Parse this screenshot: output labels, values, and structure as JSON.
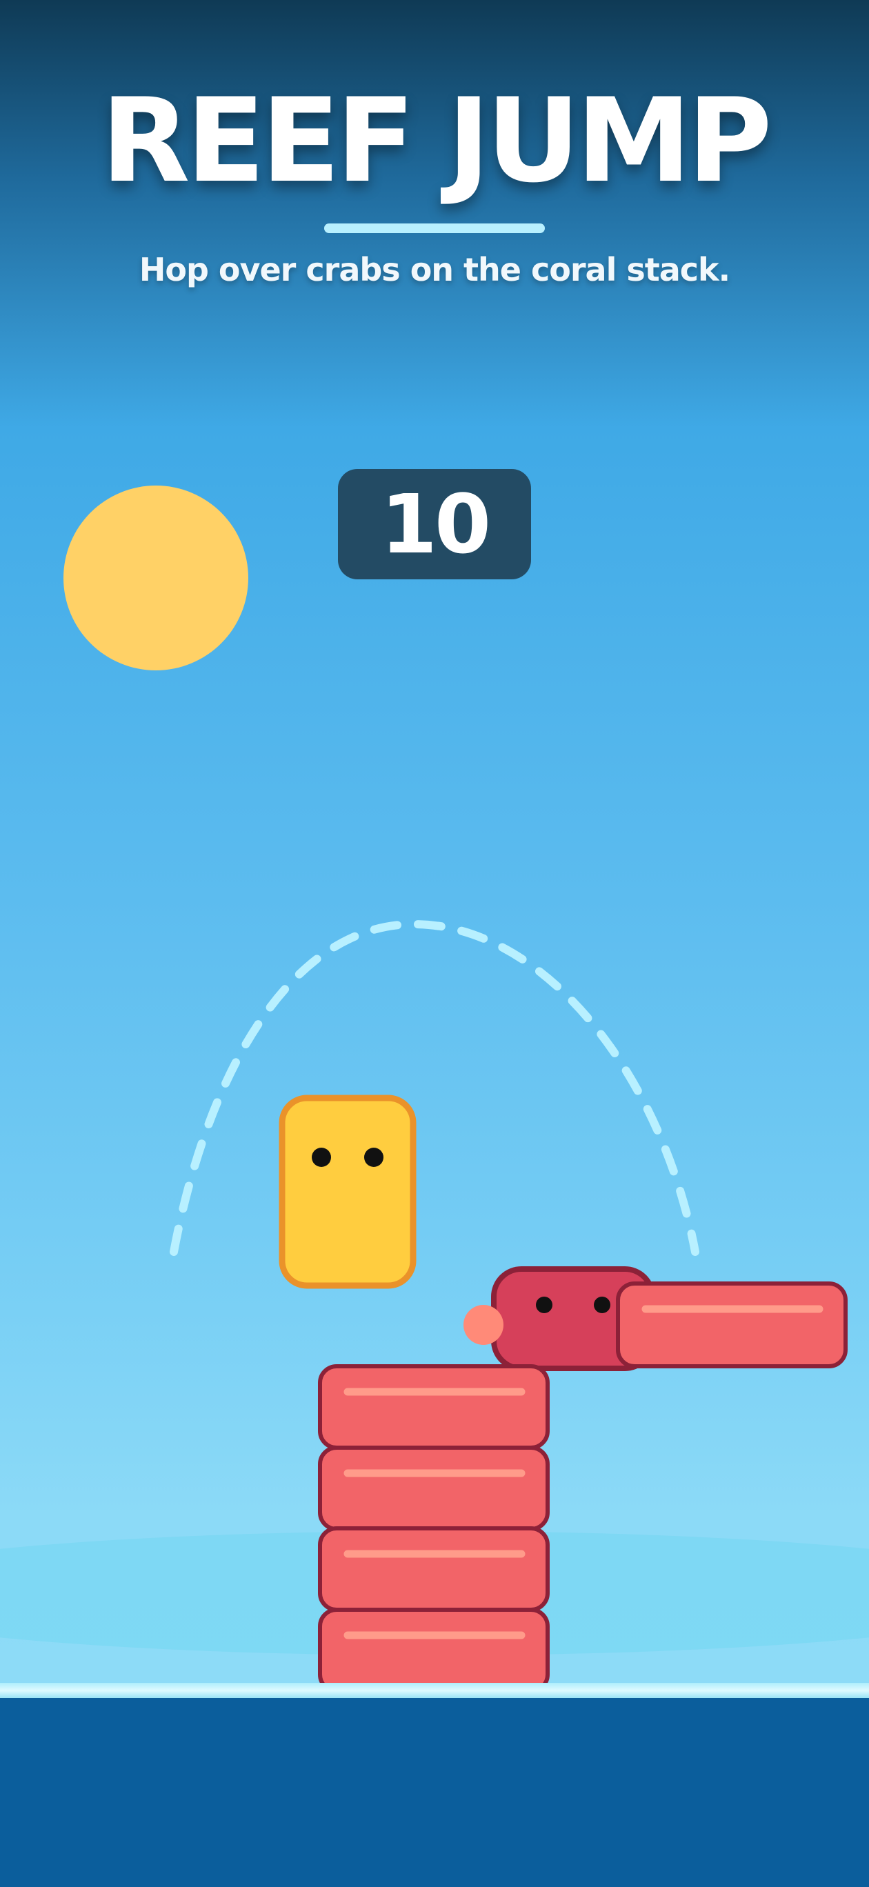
{
  "game": {
    "title": "REEF JUMP",
    "subtitle": "Hop over crabs on the coral stack.",
    "score": "10"
  },
  "scene": {
    "player": {
      "eyes": 2
    },
    "crab": {
      "eyes": 2
    },
    "coral_stack": {
      "blocks": 4
    },
    "side_block": {
      "count": 1
    },
    "jump_arc": {
      "style": "dashed"
    }
  },
  "colors": {
    "sky_top": "#0f3a55",
    "sky_bottom": "#8ddbf7",
    "sun": "#ffd166",
    "score_box": "#234b64",
    "player_fill": "#ffcd3f",
    "player_outline": "#ea922a",
    "coral_fill": "#f26468",
    "coral_outline": "#8c2138",
    "coral_stripe": "#ff9b8a",
    "crab_fill": "#d6405a",
    "crab_claw": "#ff8a78",
    "sea": "#0b5e9c",
    "arc": "#b8f0ff"
  }
}
